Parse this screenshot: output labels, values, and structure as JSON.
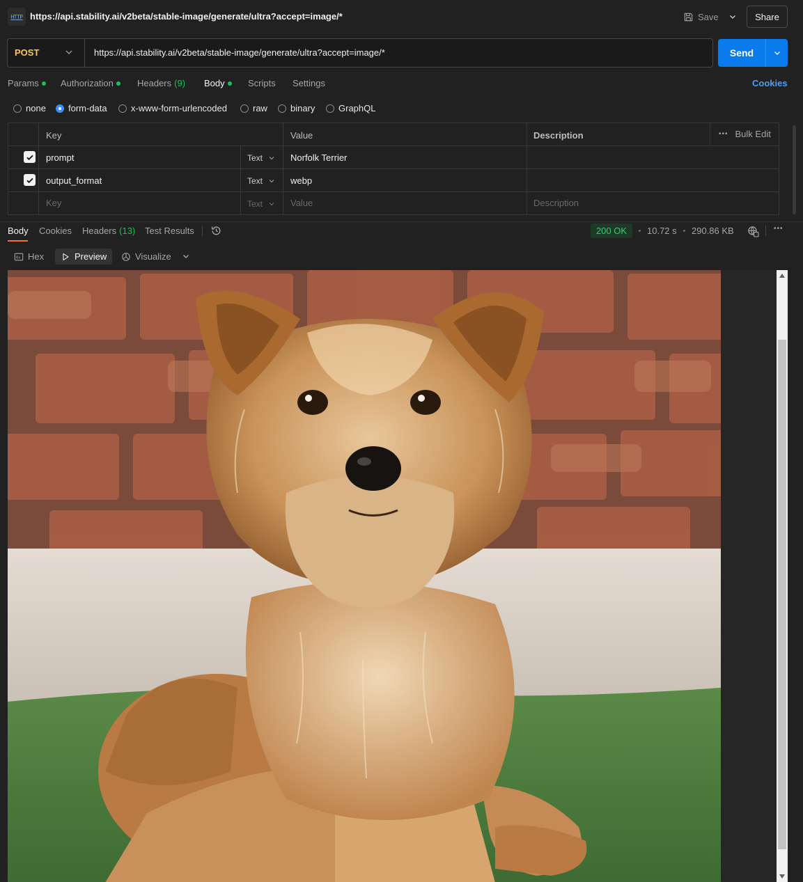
{
  "tab": {
    "title": "https://api.stability.ai/v2beta/stable-image/generate/ultra?accept=image/*",
    "icon": "http-icon",
    "icon_text": "HTTP"
  },
  "toolbar": {
    "save_label": "Save",
    "share_label": "Share"
  },
  "request": {
    "method": "POST",
    "url": "https://api.stability.ai/v2beta/stable-image/generate/ultra?accept=image/*",
    "send_label": "Send"
  },
  "request_tabs": [
    {
      "label": "Params",
      "dot": true
    },
    {
      "label": "Authorization",
      "dot": true
    },
    {
      "label": "Headers",
      "count": "(9)"
    },
    {
      "label": "Body",
      "dot": true,
      "active": true
    },
    {
      "label": "Scripts"
    },
    {
      "label": "Settings"
    }
  ],
  "cookies_link": "Cookies",
  "body_types": [
    {
      "label": "none",
      "selected": false
    },
    {
      "label": "form-data",
      "selected": true
    },
    {
      "label": "x-www-form-urlencoded",
      "selected": false
    },
    {
      "label": "raw",
      "selected": false
    },
    {
      "label": "binary",
      "selected": false
    },
    {
      "label": "GraphQL",
      "selected": false
    }
  ],
  "form_table": {
    "headers": {
      "key": "Key",
      "value": "Value",
      "description": "Description",
      "bulk_edit": "Bulk Edit"
    },
    "rows": [
      {
        "checked": true,
        "key": "prompt",
        "type": "Text",
        "value": "Norfolk Terrier",
        "description": ""
      },
      {
        "checked": true,
        "key": "output_format",
        "type": "Text",
        "value": "webp",
        "description": ""
      }
    ],
    "placeholder_row": {
      "key": "Key",
      "type": "Text",
      "value": "Value",
      "description": "Description"
    }
  },
  "response": {
    "tabs": [
      {
        "label": "Body",
        "active": true
      },
      {
        "label": "Cookies"
      },
      {
        "label": "Headers",
        "count": "(13)"
      },
      {
        "label": "Test Results"
      }
    ],
    "status": "200 OK",
    "time": "10.72 s",
    "size": "290.86 KB",
    "view_buttons": [
      {
        "label": "Hex",
        "icon": "hex-icon"
      },
      {
        "label": "Preview",
        "icon": "play-icon",
        "active": true
      },
      {
        "label": "Visualize",
        "icon": "visualize-icon"
      }
    ]
  },
  "colors": {
    "accent": "#097bed",
    "method": "#ffc94b",
    "success": "#1fbf5b",
    "active_tab_underline": "#ff6c37",
    "link": "#4a9ef7"
  }
}
